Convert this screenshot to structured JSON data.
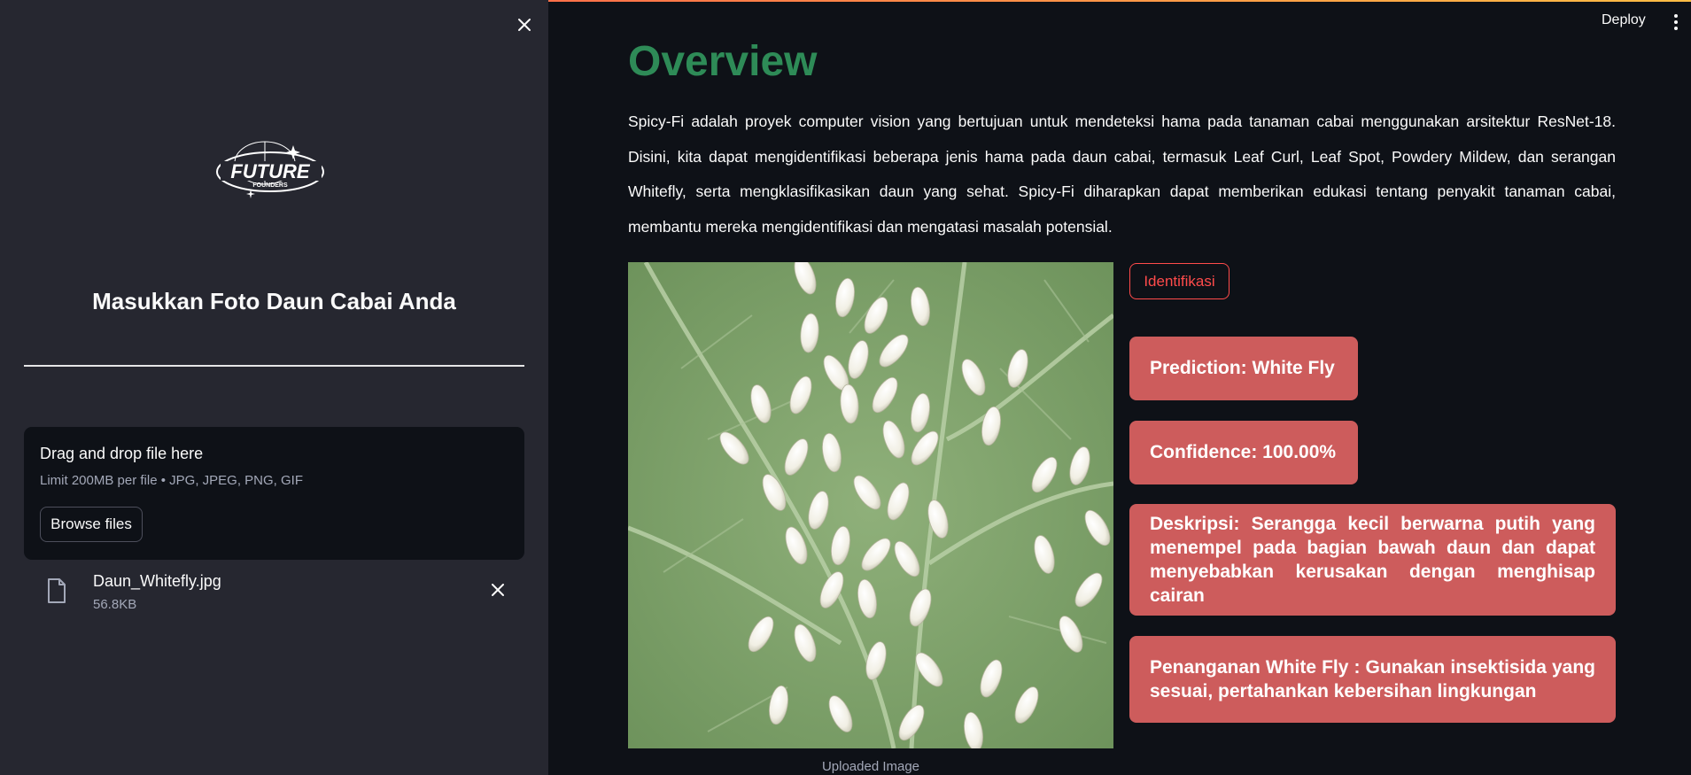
{
  "sidebar": {
    "heading": "Masukkan Foto Daun Cabai Anda",
    "logo": {
      "name": "future-founders-logo",
      "text_main": "FUTURE",
      "text_sub": "FOUNDERS"
    },
    "uploader": {
      "title": "Drag and drop file here",
      "limit": "Limit 200MB per file • JPG, JPEG, PNG, GIF",
      "browse_label": "Browse files"
    },
    "file": {
      "name": "Daun_Whitefly.jpg",
      "size": "56.8KB"
    }
  },
  "header": {
    "deploy_label": "Deploy"
  },
  "main": {
    "title": "Overview",
    "description": "Spicy-Fi adalah proyek computer vision yang bertujuan untuk mendeteksi hama pada tanaman cabai menggunakan arsitektur ResNet-18. Disini, kita dapat mengidentifikasi beberapa jenis hama pada daun cabai, termasuk Leaf Curl, Leaf Spot, Powdery Mildew, dan serangan Whitefly, serta mengklasifikasikan daun yang sehat. Spicy-Fi diharapkan dapat memberikan edukasi tentang penyakit tanaman cabai, membantu mereka mengidentifikasi dan mengatasi masalah potensial.",
    "image_caption": "Uploaded Image",
    "identify_label": "Identifikasi",
    "prediction": "Prediction: White Fly",
    "confidence": "Confidence: 100.00%",
    "deskripsi": "Deskripsi: Serangga kecil berwarna putih yang menempel pada bagian bawah daun dan dapat menyebabkan kerusakan dengan menghisap cairan",
    "penanganan": "Penanganan White Fly : Gunakan insektisida yang sesuai, pertahankan kebersihan lingkungan"
  },
  "colors": {
    "background": "#0e1117",
    "sidebar": "#262730",
    "title_green": "#2e8b57",
    "accent_red": "#ff4b4b",
    "card_red": "#cd5c5c"
  }
}
